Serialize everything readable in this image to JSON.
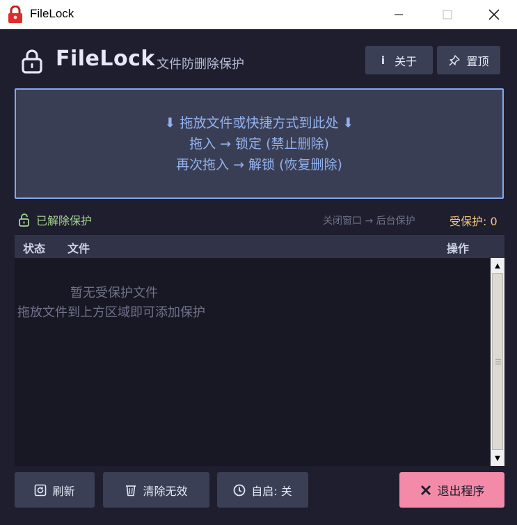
{
  "window": {
    "title": "FileLock",
    "minimize_glyph": "—",
    "maximize_glyph": "☐",
    "close_glyph": "✕"
  },
  "header": {
    "title": "FileLock",
    "subtitle": "文件防删除保护",
    "about_icon": "i",
    "about_label": "关于",
    "pin_label": "置顶"
  },
  "dropzone": {
    "line1": "⬇ 拖放文件或快捷方式到此处 ⬇",
    "line2": "拖入 → 锁定 (禁止删除)",
    "line3": "再次拖入 → 解锁 (恢复删除)"
  },
  "status": {
    "state_label": "已解除保护",
    "hint": "关闭窗口 → 后台保护",
    "protected_count": "受保护: 0"
  },
  "table": {
    "columns": [
      "状态",
      "文件",
      "操作"
    ],
    "empty_line1": "暂无受保护文件",
    "empty_line2": "拖放文件到上方区域即可添加保护"
  },
  "footer": {
    "refresh_label": "刷新",
    "clean_label": "清除无效",
    "autostart_label": "自启: 关",
    "quit_label": "退出程序"
  },
  "colors": {
    "background": "#1e1e2e",
    "panel": "#3b3f55",
    "accent_blue": "#86a8e8",
    "status_green": "#a6d78f",
    "count_yellow": "#f1c87b",
    "quit_pink": "#f38ba8"
  },
  "icons": {
    "app": "red-lock-icon",
    "header": "lock-icon",
    "about": "info-icon",
    "pin": "pin-icon",
    "status": "unlock-icon",
    "refresh": "refresh-icon",
    "clean": "trash-icon",
    "autostart": "clock-icon",
    "quit": "x-icon"
  }
}
